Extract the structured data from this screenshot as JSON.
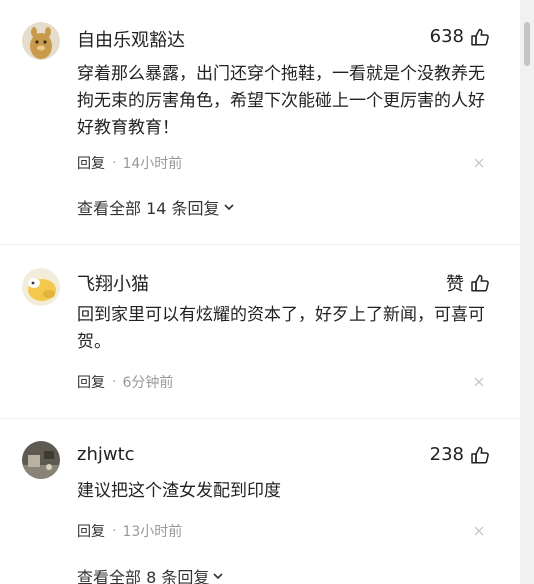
{
  "comments": [
    {
      "username": "自由乐观豁达",
      "like_count": "638",
      "text": "穿着那么暴露，出门还穿个拖鞋，一看就是个没教养无拘无束的厉害角色，希望下次能碰上一个更厉害的人好好教育教育！",
      "reply_label": "回复",
      "separator": "·",
      "time": "14小时前",
      "view_all": "查看全部 14 条回复"
    },
    {
      "username": "飞翔小猫",
      "like_count": "赞",
      "text": "回到家里可以有炫耀的资本了，好歹上了新闻，可喜可贺。",
      "reply_label": "回复",
      "separator": "·",
      "time": "6分钟前"
    },
    {
      "username": "zhjwtc",
      "like_count": "238",
      "text": "建议把这个渣女发配到印度",
      "reply_label": "回复",
      "separator": "·",
      "time": "13小时前",
      "view_all": "查看全部 8 条回复"
    }
  ],
  "icons": {
    "like": "thumbs-up-icon",
    "close": "close-icon",
    "expand": "chevron-down-icon"
  },
  "colors": {
    "text": "#222222",
    "meta": "#999999",
    "divider": "#f0f0f0"
  }
}
